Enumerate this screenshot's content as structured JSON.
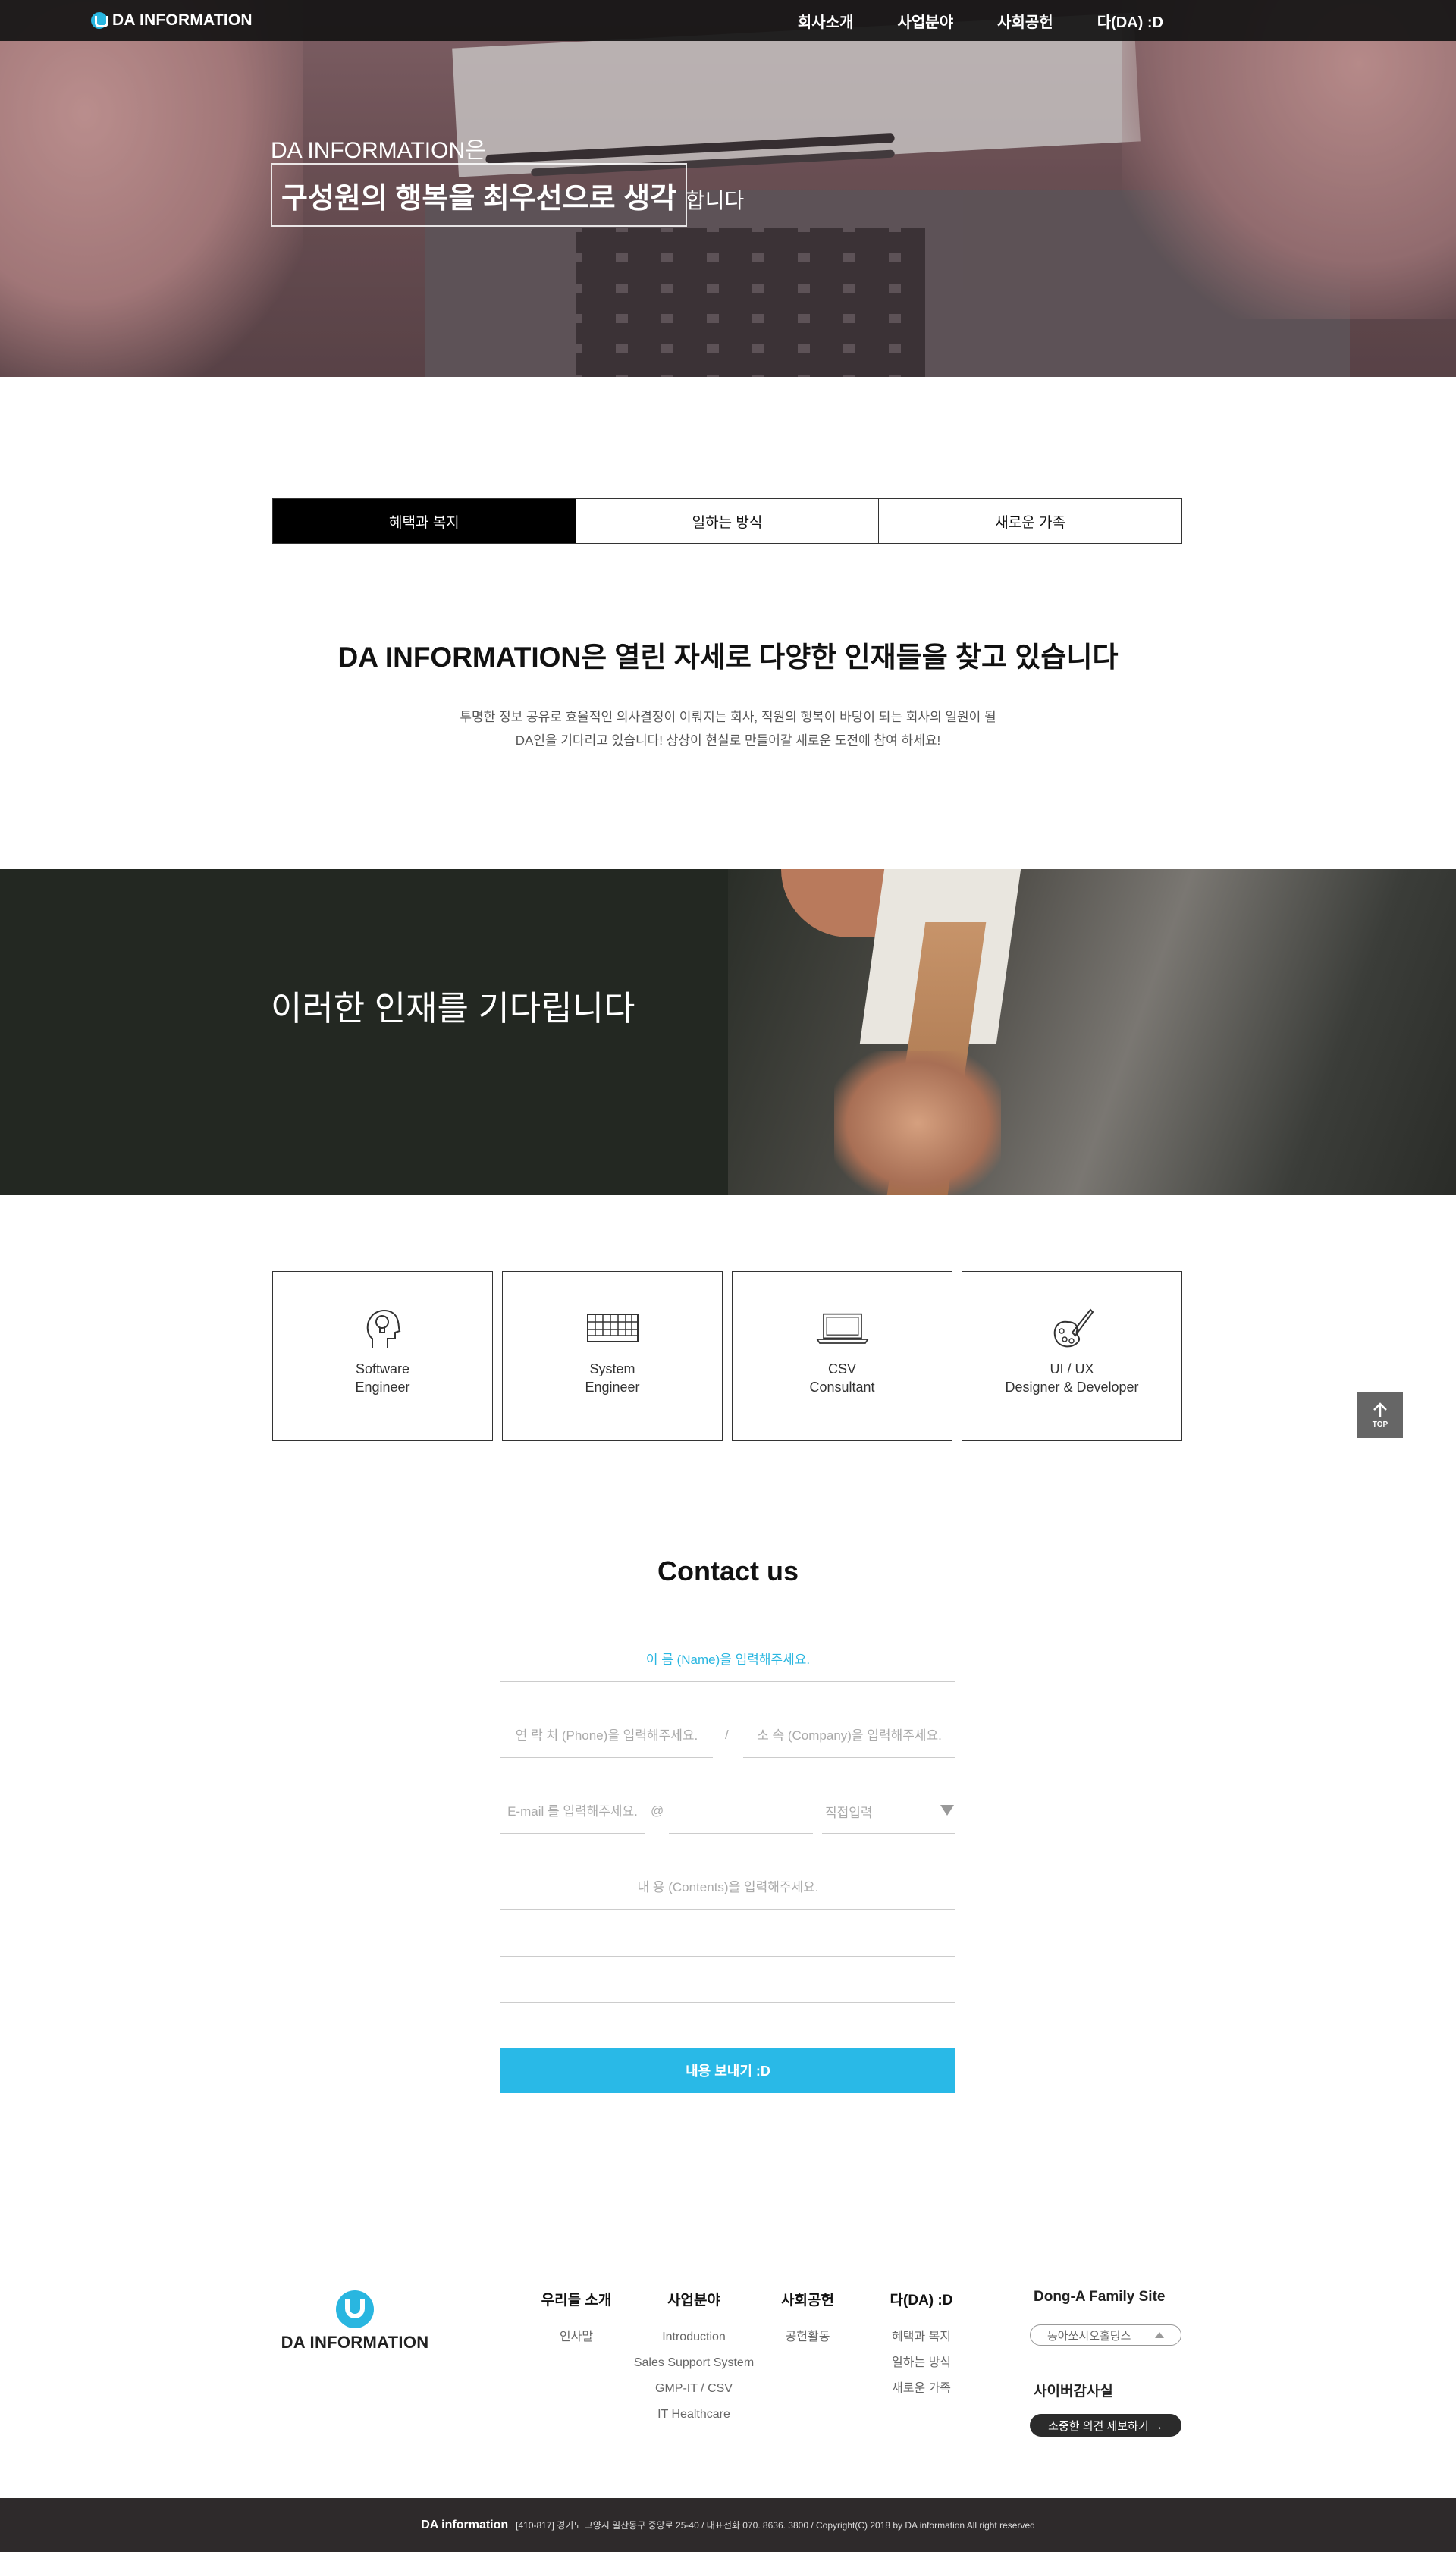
{
  "header": {
    "logo_text": "DA INFORMATION",
    "nav": [
      "회사소개",
      "사업분야",
      "사회공헌",
      "다(DA) :D"
    ]
  },
  "hero": {
    "line1": "DA INFORMATION은",
    "highlight": "구성원의 행복을 최우선으로 생각",
    "suffix": "합니다"
  },
  "tabs": [
    {
      "label": "혜택과 복지",
      "active": true
    },
    {
      "label": "일하는 방식",
      "active": false
    },
    {
      "label": "새로운 가족",
      "active": false
    }
  ],
  "intro": {
    "title": "DA INFORMATION은 열린 자세로 다양한 인재들을 찾고 있습니다",
    "desc_line1": "투명한 정보 공유로 효율적인 의사결정이 이뤄지는 회사, 직원의 행복이 바탕이 되는 회사의 일원이 될",
    "desc_line2": "DA인을 기다리고 있습니다! 상상이 현실로 만들어갈 새로운 도전에 참여 하세요!"
  },
  "banner": {
    "text": "이러한 인재를 기다립니다"
  },
  "cards": [
    {
      "line1": "Software",
      "line2": "Engineer",
      "icon": "head-lightbulb-icon"
    },
    {
      "line1": "System",
      "line2": "Engineer",
      "icon": "keyboard-icon"
    },
    {
      "line1": "CSV",
      "line2": "Consultant",
      "icon": "laptop-icon"
    },
    {
      "line1": "UI / UX",
      "line2": "Designer & Developer",
      "icon": "palette-brush-icon"
    }
  ],
  "top_button": {
    "label": "TOP"
  },
  "contact": {
    "title": "Contact us",
    "name_placeholder": "이 름 (Name)을 입력해주세요.",
    "phone_placeholder": "연 락 처 (Phone)을 입력해주세요.",
    "company_placeholder": "소 속 (Company)을 입력해주세요.",
    "slash": "/",
    "email_placeholder": "E-mail 를 입력해주세요.",
    "at": "@",
    "domain_select": "직접입력",
    "contents_placeholder": "내 용 (Contents)을 입력해주세요.",
    "submit": "내용 보내기 :D"
  },
  "footer": {
    "logo_text": "DA INFORMATION",
    "columns": [
      {
        "title": "우리들 소개",
        "items": [
          "인사말"
        ]
      },
      {
        "title": "사업분야",
        "items": [
          "Introduction",
          "Sales Support System",
          "GMP-IT / CSV",
          "IT Healthcare"
        ]
      },
      {
        "title": "사회공헌",
        "items": [
          "공헌활동"
        ]
      },
      {
        "title": "다(DA) :D",
        "items": [
          "혜택과 복지",
          "일하는 방식",
          "새로운 가족"
        ]
      }
    ],
    "family_title": "Dong-A Family Site",
    "family_select": "동아쏘시오홀딩스",
    "audit_title": "사이버감사실",
    "report_button": "소중한 의견 제보하기 →"
  },
  "bottom": {
    "brand": "DA information",
    "info": "[410-817] 경기도 고양시 일산동구 중앙로 25-40 / 대표전화 070. 8636. 3800  /  Copyright(C) 2018 by DA information All right reserved"
  },
  "colors": {
    "accent": "#29b9e7",
    "header_bg": "#141414",
    "footer_bar": "#2e2a2b"
  }
}
